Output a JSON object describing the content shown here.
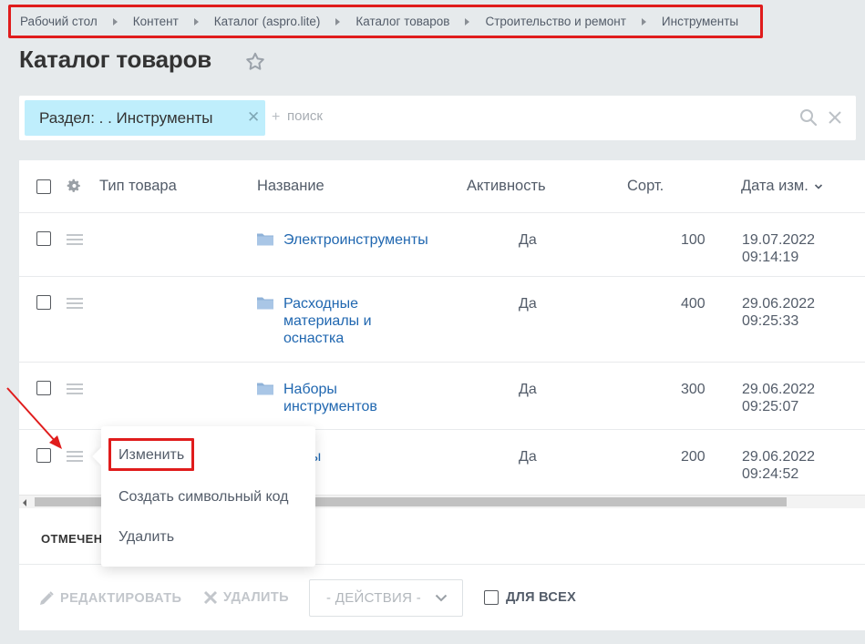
{
  "breadcrumbs": [
    "Рабочий стол",
    "Контент",
    "Каталог (aspro.lite)",
    "Каталог товаров",
    "Строительство и ремонт",
    "Инструменты"
  ],
  "page": {
    "title": "Каталог товаров"
  },
  "filter": {
    "chip_label": "Раздел: . . Инструменты",
    "search_placeholder": "+ поиск",
    "search_text": "поиск"
  },
  "table": {
    "columns": {
      "type": "Тип товара",
      "name": "Название",
      "active": "Активность",
      "sort": "Сорт.",
      "date": "Дата изм."
    },
    "rows": [
      {
        "name": "Электроинструменты",
        "active": "Да",
        "sort": "100",
        "date": "19.07.2022",
        "time": "09:14:19"
      },
      {
        "name": "Расходные материалы и оснастка",
        "active": "Да",
        "sort": "400",
        "date": "29.06.2022",
        "time": "09:25:33"
      },
      {
        "name": "Наборы инструментов",
        "active": "Да",
        "sort": "300",
        "date": "29.06.2022",
        "time": "09:25:07"
      },
      {
        "name": "Пилы",
        "active": "Да",
        "sort": "200",
        "date": "29.06.2022",
        "time": "09:24:52"
      }
    ]
  },
  "footer": {
    "selected_label": "ОТМЕЧЕНО",
    "edit_label": "РЕДАКТИРОВАТЬ",
    "delete_label": "УДАЛИТЬ",
    "actions_label": "- ДЕЙСТВИЯ -",
    "for_all_label": "ДЛЯ ВСЕХ"
  },
  "context_menu": {
    "items": [
      "Изменить",
      "Создать символьный код",
      "Удалить"
    ]
  },
  "colors": {
    "link": "#2067b0",
    "highlight": "#e01c1c",
    "chip": "#bfeefc",
    "folder": "#8fb2d8"
  }
}
